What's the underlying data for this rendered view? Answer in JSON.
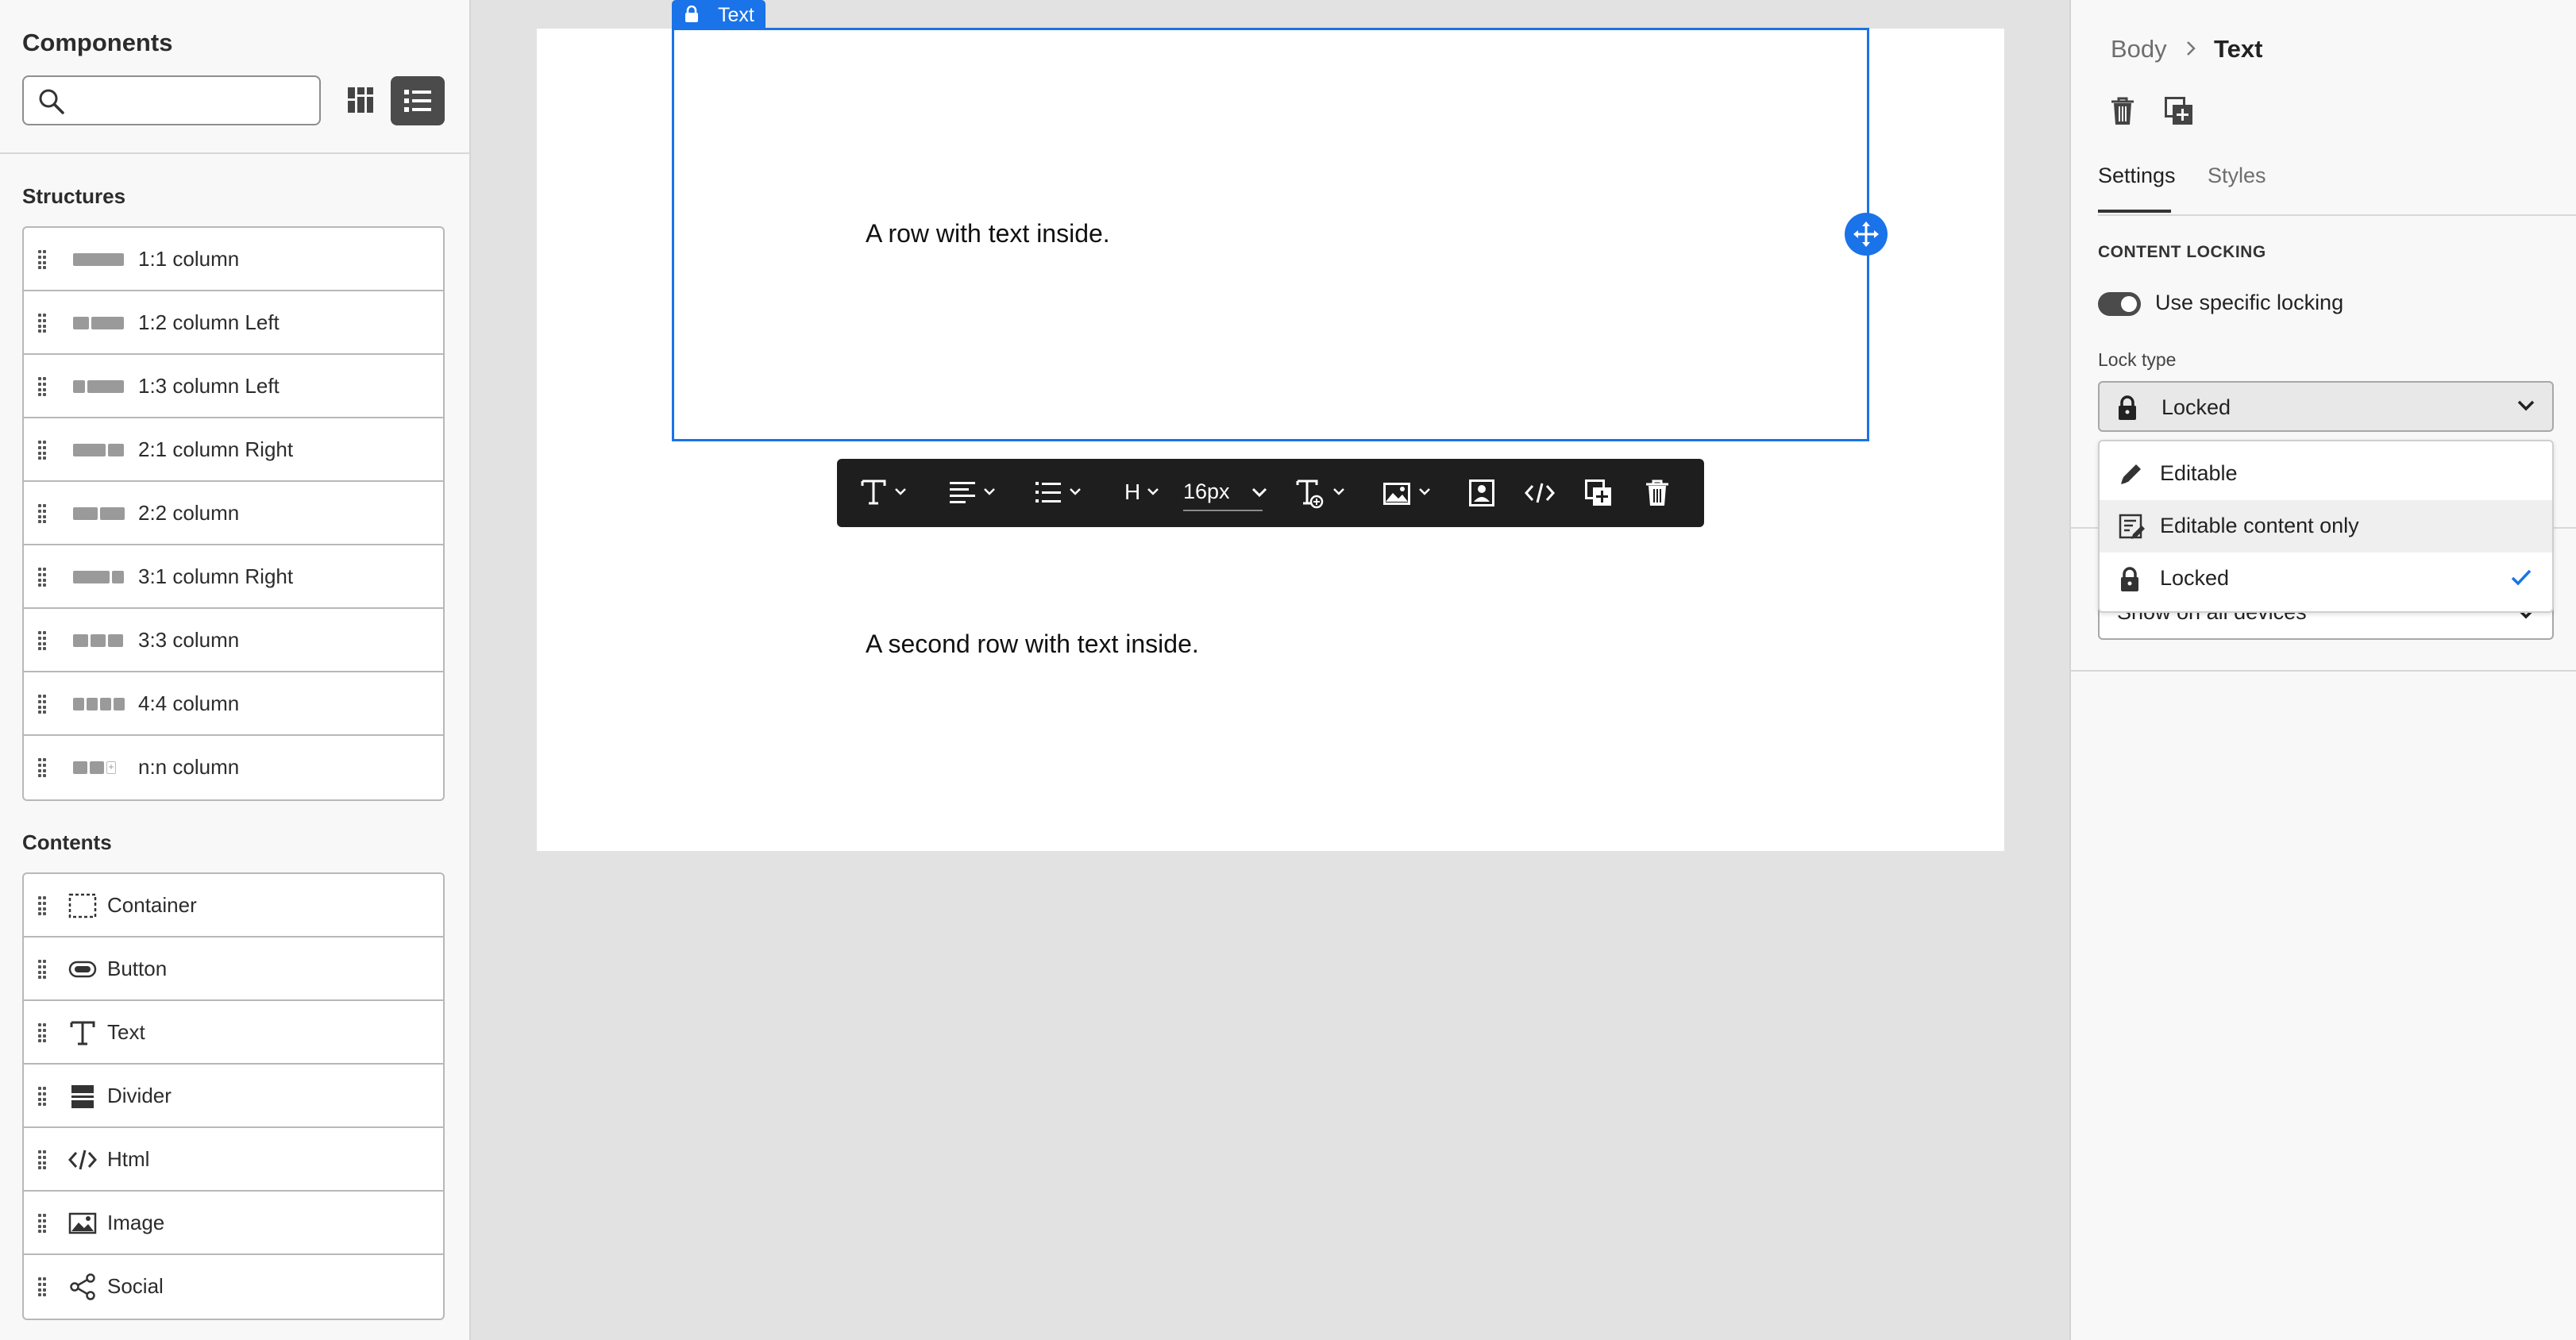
{
  "left_panel": {
    "title": "Components",
    "search": {
      "placeholder": "",
      "value": ""
    },
    "structures_title": "Structures",
    "structures": [
      {
        "label": "1:1 column",
        "cols": [
          1
        ]
      },
      {
        "label": "1:2 column Left",
        "cols": [
          1,
          2
        ]
      },
      {
        "label": "1:3 column Left",
        "cols": [
          1,
          3
        ]
      },
      {
        "label": "2:1 column Right",
        "cols": [
          2,
          1
        ]
      },
      {
        "label": "2:2 column",
        "cols": [
          1,
          1
        ]
      },
      {
        "label": "3:1 column Right",
        "cols": [
          3,
          1
        ]
      },
      {
        "label": "3:3 column",
        "cols": [
          1,
          1,
          1
        ]
      },
      {
        "label": "4:4 column",
        "cols": [
          1,
          1,
          1,
          1
        ]
      },
      {
        "label": "n:n column",
        "cols": [
          1,
          1,
          "plus"
        ]
      }
    ],
    "contents_title": "Contents",
    "contents": [
      {
        "label": "Container",
        "icon": "container-icon"
      },
      {
        "label": "Button",
        "icon": "button-icon"
      },
      {
        "label": "Text",
        "icon": "text-icon"
      },
      {
        "label": "Divider",
        "icon": "divider-icon"
      },
      {
        "label": "Html",
        "icon": "code-icon"
      },
      {
        "label": "Image",
        "icon": "image-icon"
      },
      {
        "label": "Social",
        "icon": "share-icon"
      }
    ]
  },
  "canvas": {
    "selected_tag": "Text",
    "row1_text": "A row with text inside.",
    "row2_text": "A second row with text inside.",
    "toolbar": {
      "heading_label": "H",
      "font_size": "16px"
    }
  },
  "right_panel": {
    "breadcrumb_parent": "Body",
    "breadcrumb_current": "Text",
    "tabs": [
      "Settings",
      "Styles"
    ],
    "active_tab": "Settings",
    "section_title": "CONTENT LOCKING",
    "toggle_label": "Use specific locking",
    "toggle_on": true,
    "lock_type_label": "Lock type",
    "lock_type_value": "Locked",
    "lock_options": [
      {
        "label": "Editable",
        "icon": "pencil-icon"
      },
      {
        "label": "Editable content only",
        "icon": "edit-content-icon"
      },
      {
        "label": "Locked",
        "icon": "lock-icon",
        "selected": true
      }
    ],
    "visibility_value": "Show on all devices"
  },
  "colors": {
    "accent": "#1a73e8",
    "toolbar_bg": "#1e1e1e",
    "canvas_bg": "#e2e2e2"
  }
}
